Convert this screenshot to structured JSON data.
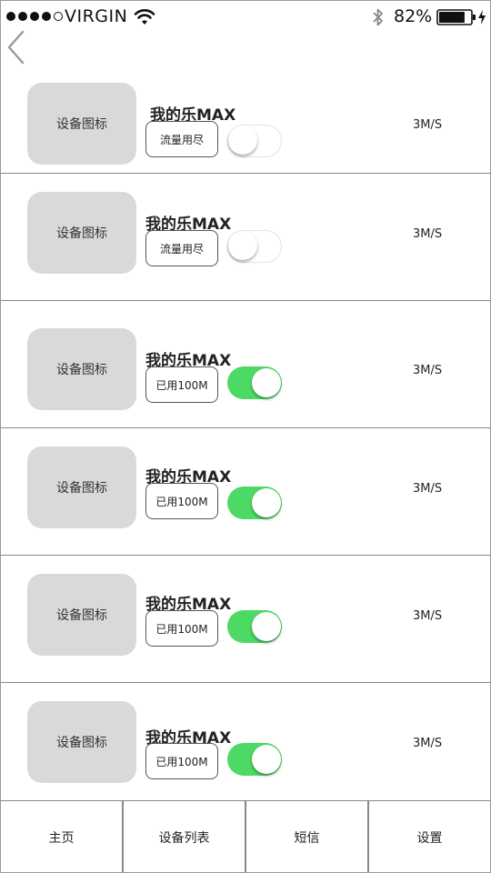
{
  "status_bar": {
    "carrier": "VIRGIN",
    "battery_percent": "82%",
    "signal_strength": 4,
    "signal_max": 5
  },
  "devices": [
    {
      "icon_label": "设备图标",
      "name": "我的乐MAX",
      "usage": "流量用尽",
      "speed": "3M/S",
      "enabled": false
    },
    {
      "icon_label": "设备图标",
      "name": "我的乐MAX",
      "usage": "流量用尽",
      "speed": "3M/S",
      "enabled": false
    },
    {
      "icon_label": "设备图标",
      "name": "我的乐MAX",
      "usage": "已用100M",
      "speed": "3M/S",
      "enabled": true
    },
    {
      "icon_label": "设备图标",
      "name": "我的乐MAX",
      "usage": "已用100M",
      "speed": "3M/S",
      "enabled": true
    },
    {
      "icon_label": "设备图标",
      "name": "我的乐MAX",
      "usage": "已用100M",
      "speed": "3M/S",
      "enabled": true
    },
    {
      "icon_label": "设备图标",
      "name": "我的乐MAX",
      "usage": "已用100M",
      "speed": "3M/S",
      "enabled": true
    }
  ],
  "tab_bar": {
    "tabs": [
      {
        "label": "主页"
      },
      {
        "label": "设备列表"
      },
      {
        "label": "短信"
      },
      {
        "label": "设置"
      }
    ]
  },
  "colors": {
    "toggle_on": "#4cd964",
    "icon_placeholder": "#d9d9d9"
  }
}
